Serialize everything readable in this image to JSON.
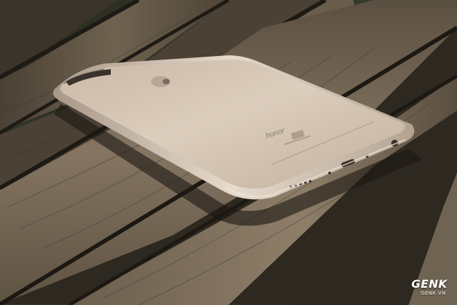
{
  "photo": {
    "subject": "gold smartphone lying face-down on wooden bench slats",
    "phone_brand_text": "honor",
    "colors": {
      "wood_dark": "#3a342c",
      "wood_light": "#8a7a66",
      "phone_body": "#d6c6b4",
      "foliage": "#3f5a2a"
    }
  },
  "watermark": {
    "logo": "GENK",
    "site": "GENK.VN"
  }
}
